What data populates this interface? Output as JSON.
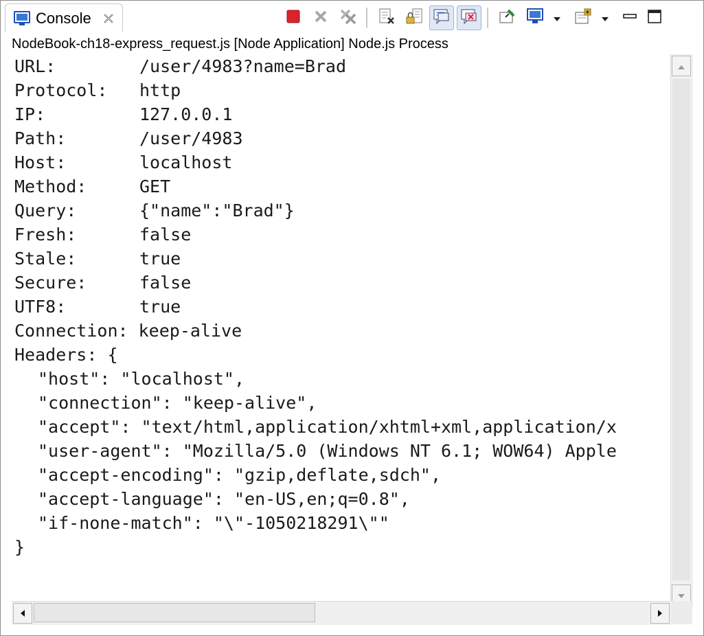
{
  "tab": {
    "label": "Console",
    "icon": "console-icon",
    "close_icon": "close-x-icon"
  },
  "toolbar": {
    "buttons": [
      {
        "name": "terminate-icon",
        "color": "#d9242b"
      },
      {
        "name": "remove-launch-icon"
      },
      {
        "name": "remove-all-terminated-icon"
      },
      {
        "name": "clear-console-icon"
      },
      {
        "name": "scroll-lock-icon"
      },
      {
        "name": "show-on-stdout-icon"
      },
      {
        "name": "show-on-stderr-icon"
      },
      {
        "name": "pin-console-icon"
      },
      {
        "name": "display-selected-console-icon"
      },
      {
        "name": "open-console-icon"
      },
      {
        "name": "minimize-icon"
      },
      {
        "name": "maximize-icon"
      }
    ]
  },
  "process_title": "NodeBook-ch18-express_request.js [Node Application] Node.js Process",
  "console": {
    "fields": [
      {
        "label": "URL:",
        "value": "/user/4983?name=Brad"
      },
      {
        "label": "Protocol:",
        "value": "http"
      },
      {
        "label": "IP:",
        "value": "127.0.0.1"
      },
      {
        "label": "Path:",
        "value": "/user/4983"
      },
      {
        "label": "Host:",
        "value": "localhost"
      },
      {
        "label": "Method:",
        "value": "GET"
      },
      {
        "label": "Query:",
        "value": "{\"name\":\"Brad\"}"
      },
      {
        "label": "Fresh:",
        "value": "false"
      },
      {
        "label": "Stale:",
        "value": "true"
      },
      {
        "label": "Secure:",
        "value": "false"
      },
      {
        "label": "UTF8:",
        "value": "true"
      }
    ],
    "connection_line": "Connection: keep-alive",
    "headers_open": "Headers: {",
    "headers": [
      "\"host\": \"localhost\",",
      "\"connection\": \"keep-alive\",",
      "\"accept\": \"text/html,application/xhtml+xml,application/x",
      "\"user-agent\": \"Mozilla/5.0 (Windows NT 6.1; WOW64) Apple",
      "\"accept-encoding\": \"gzip,deflate,sdch\",",
      "\"accept-language\": \"en-US,en;q=0.8\",",
      "\"if-none-match\": \"\\\"-1050218291\\\"\""
    ],
    "headers_close": "}"
  },
  "colors": {
    "accent": "#1f4fb4",
    "terminate": "#d9242b",
    "text": "#1a1a1a"
  }
}
